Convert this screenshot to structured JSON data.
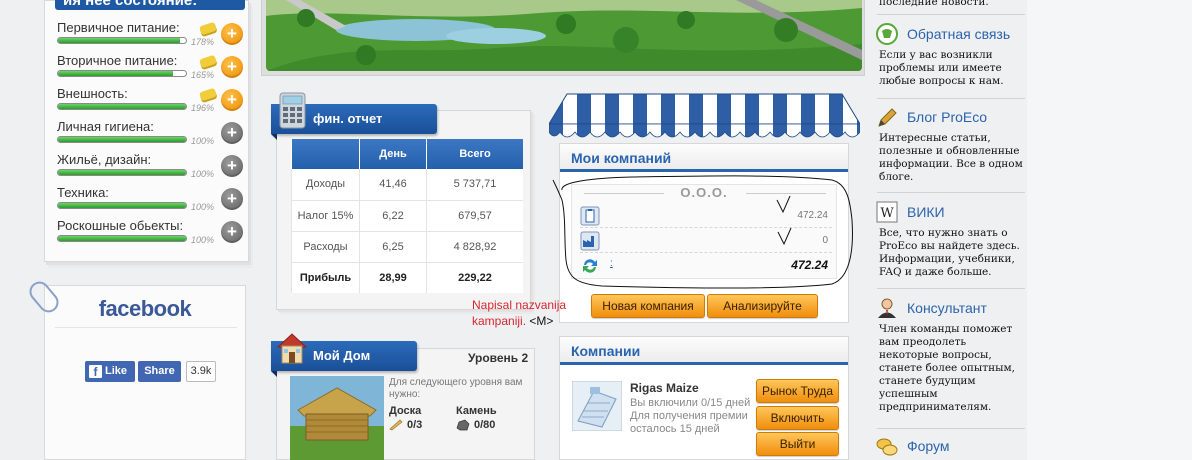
{
  "state_panel": {
    "title": "ия нее состояние:",
    "stats": [
      {
        "label": "Первичное питание:",
        "percent": "178%",
        "fill": 0.95,
        "button": "+",
        "button_color": "#f39a12",
        "coin": true
      },
      {
        "label": "Вторичное питание:",
        "percent": "165%",
        "fill": 0.9,
        "button": "+",
        "button_color": "#f39a12",
        "coin": true
      },
      {
        "label": "Внешность:",
        "percent": "196%",
        "fill": 1.0,
        "button": "+",
        "button_color": "#f39a12",
        "coin": true
      },
      {
        "label": "Личная гигиена:",
        "percent": "100%",
        "fill": 1.0,
        "button": "+",
        "button_color": "#7a7a7a",
        "coin": false
      },
      {
        "label": "Жильё, дизайн:",
        "percent": "100%",
        "fill": 1.0,
        "button": "+",
        "button_color": "#7a7a7a",
        "coin": false
      },
      {
        "label": "Техника:",
        "percent": "100%",
        "fill": 1.0,
        "button": "+",
        "button_color": "#7a7a7a",
        "coin": false
      },
      {
        "label": "Роскошные обьекты:",
        "percent": "100%",
        "fill": 1.0,
        "button": "+",
        "button_color": "#7a7a7a",
        "coin": false
      }
    ]
  },
  "facebook": {
    "logo": "facebook",
    "like_label": "Like",
    "share_label": "Share",
    "count": "3.9k",
    "brand_color": "#3b5998"
  },
  "fin_report": {
    "title": "фин. отчет",
    "columns": [
      "",
      "День",
      "Всего"
    ],
    "rows": [
      {
        "label": "Доходы",
        "day": "41,46",
        "total": "5 737,71"
      },
      {
        "label": "Налог 15%",
        "day": "6,22",
        "total": "679,57"
      },
      {
        "label": "Расходы",
        "day": "6,25",
        "total": "4 828,92"
      },
      {
        "label": "Прибыль",
        "day": "28,99",
        "total": "229,22"
      }
    ]
  },
  "my_home": {
    "title": "Мой Дом",
    "level": "Уровень 2",
    "need_text": "Для следующего уровня вам нужно:",
    "resources": [
      {
        "label": "Доска",
        "value": "0/3",
        "icon": "plank-icon"
      },
      {
        "label": "Камень",
        "value": "0/80",
        "icon": "stone-icon"
      }
    ]
  },
  "my_companies": {
    "title": "Мои компаний",
    "company_type": "О.О.О.",
    "rows": [
      {
        "icon": "clipboard-icon",
        "value": "472.24"
      },
      {
        "icon": "factory-icon",
        "value": "0"
      }
    ],
    "total_link": ":",
    "total": "472.24",
    "buttons": {
      "new_company": "Новая компания",
      "analyze": "Анализируйте"
    },
    "accent": "#2a64b1"
  },
  "annotation": {
    "text": "Napisal nazvanija kampaniji.",
    "signature": "<M>",
    "color": "#d7262e"
  },
  "companies": {
    "title": "Компании",
    "item": {
      "name": "Rigas Maize",
      "status": "Вы включили 0/15 дней",
      "premium": "Для получения премии осталось 15 дней"
    },
    "buttons": {
      "labor_market": "Рынок Труда",
      "enable": "Включить",
      "exit": "Выйти"
    }
  },
  "sidebar": {
    "top_text": "последние новости.",
    "sections": [
      {
        "icon": "feedback-icon",
        "title": "Обратная связь",
        "text": "Если у вас возникли проблемы или имеете любые вопросы к нам."
      },
      {
        "icon": "blog-icon",
        "title": "Блог ProEco",
        "text": "Интересные статьи, полезные и обновленные информации. Все в одном блоге."
      },
      {
        "icon": "wiki-icon",
        "title": "ВИКИ",
        "text": "Все, что нужно знать о ProEco вы найдете здесь. Информации, учебники, FAQ и даже больше."
      },
      {
        "icon": "consultant-icon",
        "title": "Консультант",
        "text": "Член команды поможет вам преодолеть некоторые вопросы, станете более опытным, станете будущим успешным предпринимателям."
      },
      {
        "icon": "forum-icon",
        "title": "Форум",
        "text": ""
      }
    ]
  }
}
